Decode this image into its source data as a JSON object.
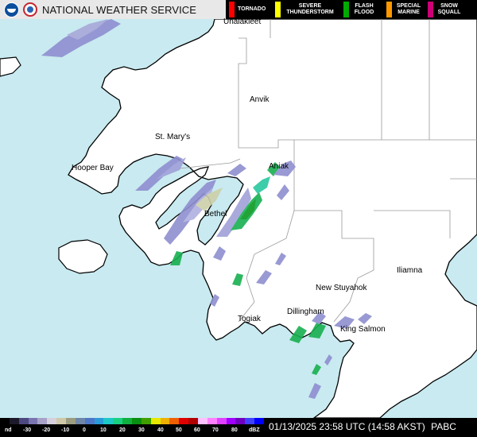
{
  "header": {
    "agency": "NATIONAL WEATHER SERVICE",
    "legend": [
      {
        "label": "TORNADO",
        "color": "#ff0000"
      },
      {
        "label": "SEVERE THUNDERSTORM",
        "color": "#ffff00"
      },
      {
        "label": "FLASH FLOOD",
        "color": "#00aa00"
      },
      {
        "label": "SPECIAL MARINE",
        "color": "#ff9900"
      },
      {
        "label": "SNOW SQUALL",
        "color": "#cc0077"
      }
    ]
  },
  "places": [
    "Unalakleet",
    "Anvik",
    "St. Mary's",
    "Hooper Bay",
    "Aniak",
    "Bethel",
    "New Stuyahok",
    "Iliamna",
    "Dillingham",
    "Togiak",
    "King Salmon"
  ],
  "footer": {
    "scale_labels": [
      "nd",
      "-30",
      "-20",
      "-10",
      "0",
      "10",
      "20",
      "30",
      "40",
      "50",
      "60",
      "70",
      "80",
      "dBZ"
    ],
    "timestamp": "01/13/2025 23:58 UTC (14:58 AKST)",
    "station": "PABC"
  },
  "colors": {
    "water": "#c8eaf0",
    "land": "#ffffff",
    "coast": "#000000",
    "borders": "#808080",
    "scale": [
      "#000000",
      "#1c1a2a",
      "#4c4880",
      "#7a74b0",
      "#a8a2c8",
      "#d6d0dc",
      "#cfc8a8",
      "#9c9c80",
      "#6e86a8",
      "#4c76c8",
      "#2a9ad8",
      "#1cc8c8",
      "#18d080",
      "#10b040",
      "#0a9010",
      "#40a000",
      "#e8e800",
      "#f0b000",
      "#f06000",
      "#e00000",
      "#b00000",
      "#ffc0ff",
      "#ff80ff",
      "#e040ff",
      "#a000ff",
      "#7000c0",
      "#4040ff",
      "#0000ff"
    ]
  }
}
